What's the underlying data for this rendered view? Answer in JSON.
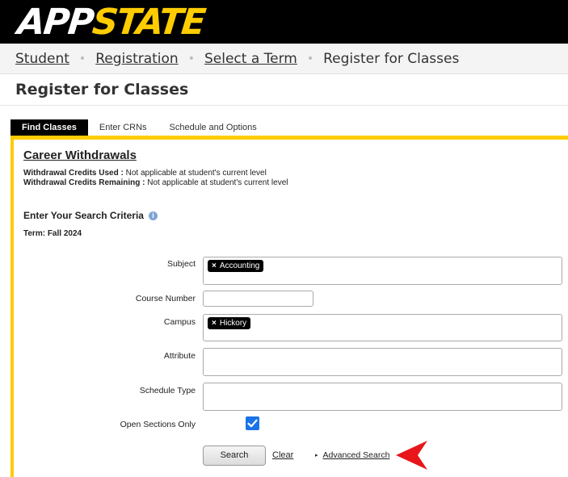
{
  "header": {
    "logo_app": "APP",
    "logo_state": "STATE"
  },
  "breadcrumb": {
    "items": [
      "Student",
      "Registration",
      "Select a Term"
    ],
    "current": "Register for Classes",
    "separator": "•"
  },
  "page": {
    "title": "Register for Classes"
  },
  "tabs": [
    {
      "label": "Find Classes",
      "active": true
    },
    {
      "label": "Enter CRNs",
      "active": false
    },
    {
      "label": "Schedule and Options",
      "active": false
    }
  ],
  "career_withdrawals": {
    "title": "Career Withdrawals",
    "used_label": "Withdrawal Credits Used :",
    "used_value": "Not applicable at student's current level",
    "remaining_label": "Withdrawal Credits Remaining :",
    "remaining_value": "Not applicable at student's current level"
  },
  "search": {
    "heading": "Enter Your Search Criteria",
    "info_icon": "i",
    "term": "Term: Fall 2024",
    "subject_label": "Subject",
    "subject_chip": "Accounting",
    "course_number_label": "Course Number",
    "campus_label": "Campus",
    "campus_chip": "Hickory",
    "attribute_label": "Attribute",
    "schedule_type_label": "Schedule Type",
    "open_sections_label": "Open Sections Only",
    "open_sections_checked": true,
    "chip_remove": "×",
    "search_button": "Search",
    "clear_link": "Clear",
    "advanced_search_link": "Advanced Search",
    "advanced_toggle": "▸"
  },
  "colors": {
    "brand_gold": "#ffcc00",
    "checkbox_blue": "#1a73e8",
    "annotation_red": "#e8151b"
  }
}
